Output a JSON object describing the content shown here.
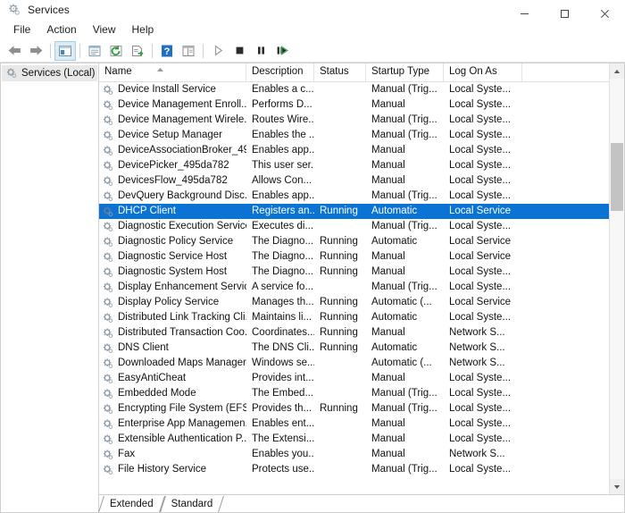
{
  "window": {
    "title": "Services",
    "icon": "services-gear-icon",
    "controls": {
      "minimize": "─",
      "maximize": "□",
      "close": "✕"
    }
  },
  "menubar": {
    "items": [
      {
        "label": "File",
        "name": "menu-file"
      },
      {
        "label": "Action",
        "name": "menu-action"
      },
      {
        "label": "View",
        "name": "menu-view"
      },
      {
        "label": "Help",
        "name": "menu-help"
      }
    ]
  },
  "toolbar": {
    "buttons": [
      {
        "name": "back-button",
        "icon": "back-arrow-icon",
        "title": "Back"
      },
      {
        "name": "forward-button",
        "icon": "forward-arrow-icon",
        "title": "Forward"
      },
      {
        "name": "show-hide-tree-button",
        "icon": "console-tree-icon",
        "title": "Show/Hide Console Tree",
        "active": true
      },
      {
        "name": "properties-button",
        "icon": "properties-icon",
        "title": "Properties"
      },
      {
        "name": "refresh-button",
        "icon": "refresh-icon",
        "title": "Refresh"
      },
      {
        "name": "export-list-button",
        "icon": "export-list-icon",
        "title": "Export List"
      },
      {
        "name": "help-button",
        "icon": "help-question-icon",
        "title": "Help"
      },
      {
        "name": "view-toggle-button",
        "icon": "view-layout-icon",
        "title": "View"
      },
      {
        "name": "start-service-button",
        "icon": "play-triangle-icon",
        "title": "Start Service"
      },
      {
        "name": "stop-service-button",
        "icon": "stop-square-icon",
        "title": "Stop Service"
      },
      {
        "name": "pause-service-button",
        "icon": "pause-bars-icon",
        "title": "Pause Service"
      },
      {
        "name": "restart-service-button",
        "icon": "restart-play-icon",
        "title": "Restart Service"
      }
    ]
  },
  "tree": {
    "root": {
      "label": "Services (Local)",
      "icon": "services-gear-icon",
      "selected": true
    }
  },
  "list": {
    "sort": {
      "column": "Name",
      "direction": "ascending",
      "glyph": "▲"
    },
    "columns": [
      {
        "key": "name",
        "label": "Name"
      },
      {
        "key": "description",
        "label": "Description"
      },
      {
        "key": "status",
        "label": "Status"
      },
      {
        "key": "startup",
        "label": "Startup Type"
      },
      {
        "key": "logon",
        "label": "Log On As"
      }
    ],
    "rows": [
      {
        "name": "Device Install Service",
        "description": "Enables a c...",
        "status": "",
        "startup": "Manual (Trig...",
        "logon": "Local Syste...",
        "selected": false
      },
      {
        "name": "Device Management Enroll...",
        "description": "Performs D...",
        "status": "",
        "startup": "Manual",
        "logon": "Local Syste...",
        "selected": false
      },
      {
        "name": "Device Management Wirele...",
        "description": "Routes Wire...",
        "status": "",
        "startup": "Manual (Trig...",
        "logon": "Local Syste...",
        "selected": false
      },
      {
        "name": "Device Setup Manager",
        "description": "Enables the ...",
        "status": "",
        "startup": "Manual (Trig...",
        "logon": "Local Syste...",
        "selected": false
      },
      {
        "name": "DeviceAssociationBroker_49...",
        "description": "Enables app...",
        "status": "",
        "startup": "Manual",
        "logon": "Local Syste...",
        "selected": false
      },
      {
        "name": "DevicePicker_495da782",
        "description": "This user ser...",
        "status": "",
        "startup": "Manual",
        "logon": "Local Syste...",
        "selected": false
      },
      {
        "name": "DevicesFlow_495da782",
        "description": "Allows Con...",
        "status": "",
        "startup": "Manual",
        "logon": "Local Syste...",
        "selected": false
      },
      {
        "name": "DevQuery Background Disc...",
        "description": "Enables app...",
        "status": "",
        "startup": "Manual (Trig...",
        "logon": "Local Syste...",
        "selected": false
      },
      {
        "name": "DHCP Client",
        "description": "Registers an...",
        "status": "Running",
        "startup": "Automatic",
        "logon": "Local Service",
        "selected": true
      },
      {
        "name": "Diagnostic Execution Service",
        "description": "Executes di...",
        "status": "",
        "startup": "Manual (Trig...",
        "logon": "Local Syste...",
        "selected": false
      },
      {
        "name": "Diagnostic Policy Service",
        "description": "The Diagno...",
        "status": "Running",
        "startup": "Automatic",
        "logon": "Local Service",
        "selected": false
      },
      {
        "name": "Diagnostic Service Host",
        "description": "The Diagno...",
        "status": "Running",
        "startup": "Manual",
        "logon": "Local Service",
        "selected": false
      },
      {
        "name": "Diagnostic System Host",
        "description": "The Diagno...",
        "status": "Running",
        "startup": "Manual",
        "logon": "Local Syste...",
        "selected": false
      },
      {
        "name": "Display Enhancement Service",
        "description": "A service fo...",
        "status": "",
        "startup": "Manual (Trig...",
        "logon": "Local Syste...",
        "selected": false
      },
      {
        "name": "Display Policy Service",
        "description": "Manages th...",
        "status": "Running",
        "startup": "Automatic (...",
        "logon": "Local Service",
        "selected": false
      },
      {
        "name": "Distributed Link Tracking Cli...",
        "description": "Maintains li...",
        "status": "Running",
        "startup": "Automatic",
        "logon": "Local Syste...",
        "selected": false
      },
      {
        "name": "Distributed Transaction Coo...",
        "description": "Coordinates...",
        "status": "Running",
        "startup": "Manual",
        "logon": "Network S...",
        "selected": false
      },
      {
        "name": "DNS Client",
        "description": "The DNS Cli...",
        "status": "Running",
        "startup": "Automatic",
        "logon": "Network S...",
        "selected": false
      },
      {
        "name": "Downloaded Maps Manager",
        "description": "Windows se...",
        "status": "",
        "startup": "Automatic (...",
        "logon": "Network S...",
        "selected": false
      },
      {
        "name": "EasyAntiCheat",
        "description": "Provides int...",
        "status": "",
        "startup": "Manual",
        "logon": "Local Syste...",
        "selected": false
      },
      {
        "name": "Embedded Mode",
        "description": "The Embed...",
        "status": "",
        "startup": "Manual (Trig...",
        "logon": "Local Syste...",
        "selected": false
      },
      {
        "name": "Encrypting File System (EFS)",
        "description": "Provides th...",
        "status": "Running",
        "startup": "Manual (Trig...",
        "logon": "Local Syste...",
        "selected": false
      },
      {
        "name": "Enterprise App Managemen...",
        "description": "Enables ent...",
        "status": "",
        "startup": "Manual",
        "logon": "Local Syste...",
        "selected": false
      },
      {
        "name": "Extensible Authentication P...",
        "description": "The Extensi...",
        "status": "",
        "startup": "Manual",
        "logon": "Local Syste...",
        "selected": false
      },
      {
        "name": "Fax",
        "description": "Enables you...",
        "status": "",
        "startup": "Manual",
        "logon": "Network S...",
        "selected": false
      },
      {
        "name": "File History Service",
        "description": "Protects use...",
        "status": "",
        "startup": "Manual (Trig...",
        "logon": "Local Syste...",
        "selected": false
      }
    ]
  },
  "tabs": [
    {
      "label": "Extended",
      "name": "tab-extended",
      "active": false
    },
    {
      "label": "Standard",
      "name": "tab-standard",
      "active": true
    }
  ],
  "scrollbar": {
    "up_glyph": "˄",
    "down_glyph": "˅"
  },
  "colors": {
    "selection": "#0a73d4",
    "selection_text": "#ffffff",
    "toolbar_active": "#dcecf7",
    "border": "#cfcfcf",
    "tree_selected": "#e8e8e8"
  }
}
